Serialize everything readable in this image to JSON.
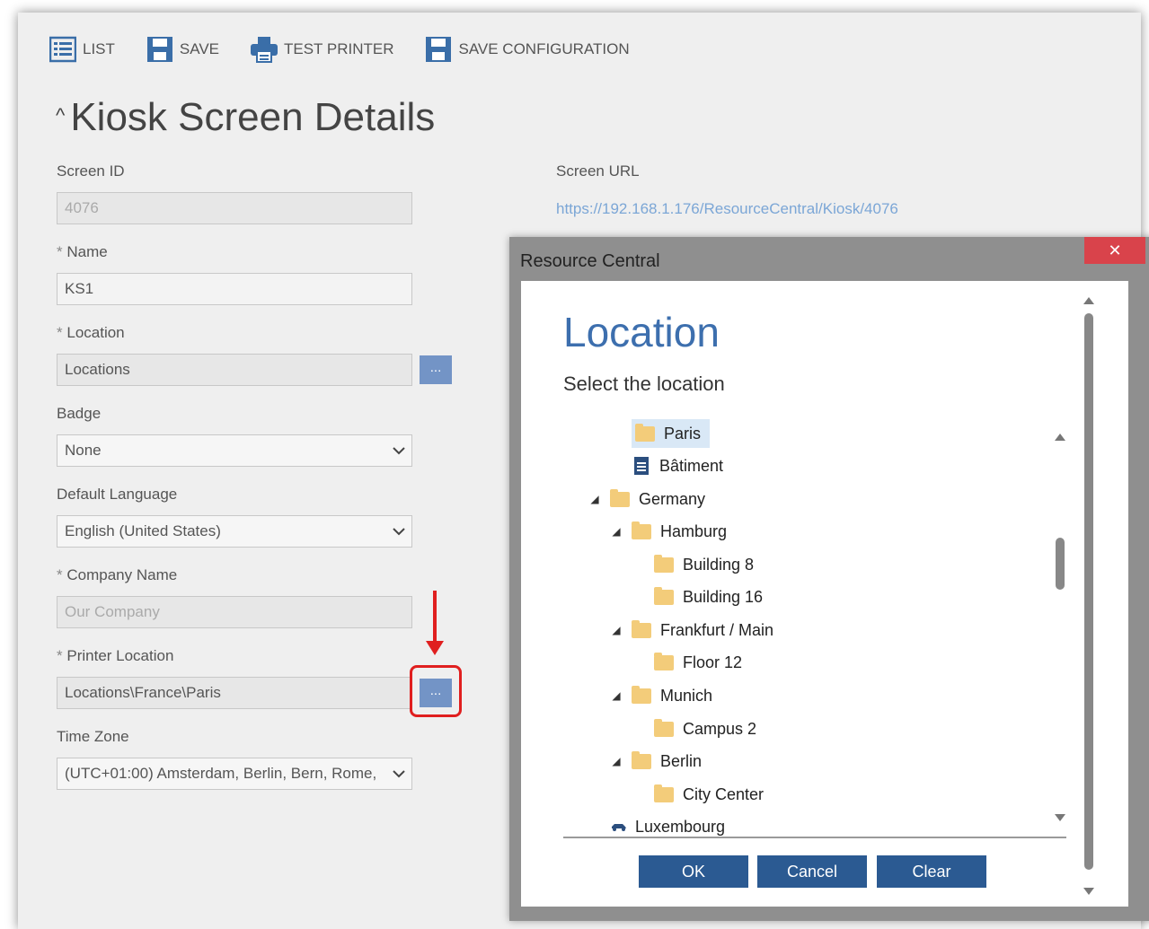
{
  "toolbar": {
    "list_label": "LIST",
    "save_label": "SAVE",
    "test_printer_label": "TEST PRINTER",
    "save_config_label": "SAVE CONFIGURATION"
  },
  "page": {
    "caret": "^",
    "title": "Kiosk Screen Details"
  },
  "form": {
    "screen_id_label": "Screen ID",
    "screen_id_value": "4076",
    "screen_url_label": "Screen URL",
    "screen_url_value": "https://192.168.1.176/ResourceCentral/Kiosk/4076",
    "required_mark": "*",
    "name_label": "Name",
    "name_value": "KS1",
    "location_label": "Location",
    "location_value": "Locations",
    "badge_label": "Badge",
    "badge_value": "None",
    "language_label": "Default Language",
    "language_value": "English (United States)",
    "company_label": "Company Name",
    "company_placeholder": "Our Company",
    "printer_label": "Printer Location",
    "printer_value": "Locations\\France\\Paris",
    "timezone_label": "Time Zone",
    "timezone_value": "(UTC+01:00) Amsterdam, Berlin, Bern, Rome,",
    "browse_label": "...",
    "dropdown_glyph": "⌄"
  },
  "dialog": {
    "window_title": "Resource Central",
    "close_label": "✕",
    "heading": "Location",
    "subheading": "Select the location",
    "tree": [
      {
        "label": "Paris",
        "icon": "folder-icon",
        "selected": true
      },
      {
        "label": "Bâtiment",
        "icon": "document-icon"
      },
      {
        "label": "Germany",
        "icon": "folder-icon",
        "expander": "◢"
      },
      {
        "label": "Hamburg",
        "icon": "folder-icon",
        "expander": "◢"
      },
      {
        "label": "Building 8",
        "icon": "folder-icon"
      },
      {
        "label": "Building 16",
        "icon": "folder-icon"
      },
      {
        "label": "Frankfurt / Main",
        "icon": "folder-icon",
        "expander": "◢"
      },
      {
        "label": "Floor 12",
        "icon": "folder-icon"
      },
      {
        "label": "Munich",
        "icon": "folder-icon",
        "expander": "◢"
      },
      {
        "label": "Campus 2",
        "icon": "folder-icon"
      },
      {
        "label": "Berlin",
        "icon": "folder-icon",
        "expander": "◢"
      },
      {
        "label": "City Center",
        "icon": "folder-icon"
      },
      {
        "label": "Luxembourg",
        "icon": "car-icon"
      }
    ],
    "ok_label": "OK",
    "cancel_label": "Cancel",
    "clear_label": "Clear"
  },
  "colors": {
    "accent_blue": "#2b5a92",
    "heading_blue": "#3d6fae",
    "close_red": "#d9434b",
    "annotation_red": "#e01f1f",
    "browse_button": "#7394c6"
  }
}
